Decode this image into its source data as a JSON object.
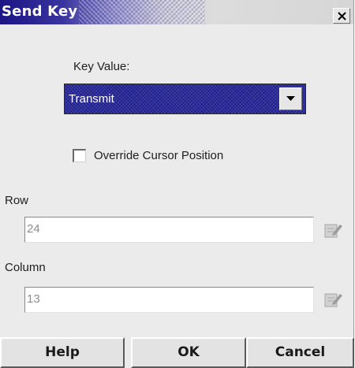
{
  "window": {
    "title": "Send Key",
    "close_icon": "close-icon"
  },
  "key_value": {
    "label": "Key Value:",
    "selected": "Transmit",
    "dropdown_icon": "chevron-down-icon"
  },
  "override": {
    "label": "Override Cursor Position",
    "checked": false
  },
  "row": {
    "label": "Row",
    "value": "24",
    "edit_icon": "edit-icon"
  },
  "column": {
    "label": "Column",
    "value": "13",
    "edit_icon": "edit-icon"
  },
  "buttons": {
    "help": "Help",
    "ok": "OK",
    "cancel": "Cancel"
  },
  "colors": {
    "title_bar_start": "#1b1585",
    "selection_bg": "#1f1f8f",
    "dialog_bg": "#ebebeb"
  }
}
